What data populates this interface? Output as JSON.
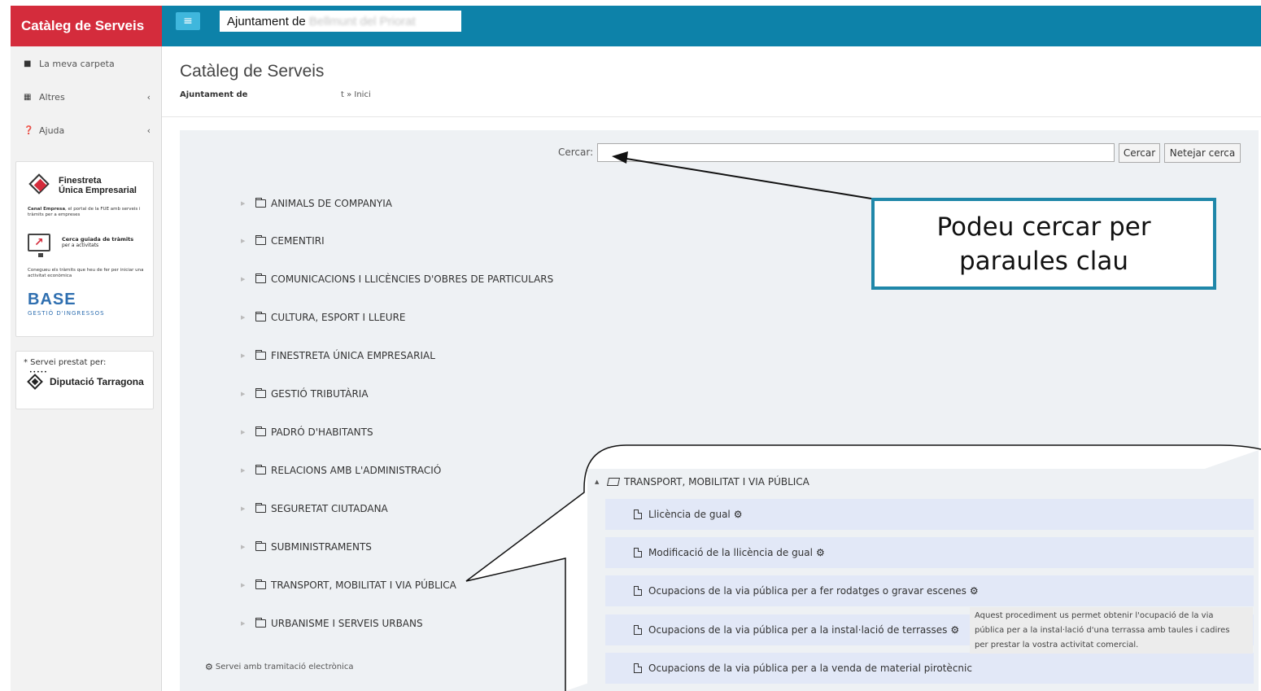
{
  "brand": {
    "title": "Catàleg de Serveis"
  },
  "sidebar": {
    "items": [
      {
        "label": "La meva carpeta",
        "icon": "folder-icon"
      },
      {
        "label": "Altres",
        "icon": "grid-icon",
        "chevron": "‹"
      },
      {
        "label": "Ajuda",
        "icon": "help-icon",
        "chevron": "‹"
      }
    ],
    "fue": {
      "line1": "Finestreta",
      "line2": "Única Empresarial",
      "desc_bold": "Canal Empresa",
      "desc": ", el portal de la FUE amb serveis i tràmits per a empreses",
      "cerca_title": "Cerca guiada de tràmits",
      "cerca_sub": "per a activitats",
      "cerca_desc": "Conegueu els tràmits que heu de fer per iniciar una activitat econòmica",
      "base": "BASE",
      "base_sub": "GESTIÓ D'INGRESSOS"
    },
    "servei": {
      "label": "* Servei prestat per:",
      "name": "Diputació Tarragona"
    }
  },
  "topbar": {
    "menu_icon": "≡",
    "org_visible": "Ajuntament de",
    "org_blurred": "Bellmunt del Priorat",
    "color": "#0d82a9"
  },
  "page": {
    "title": "Catàleg de Serveis",
    "breadcrumb_first": "Ajuntament de",
    "breadcrumb_rest": "t » Inici"
  },
  "search": {
    "label": "Cercar:",
    "value": "",
    "search_button": "Cercar",
    "clear_button": "Netejar cerca"
  },
  "categories": [
    "ANIMALS DE COMPANYIA",
    "CEMENTIRI",
    "COMUNICACIONS I LLICÈNCIES D'OBRES DE PARTICULARS",
    "CULTURA, ESPORT I LLEURE",
    "FINESTRETA ÚNICA EMPRESARIAL",
    "GESTIÓ TRIBUTÀRIA",
    "PADRÓ D'HABITANTS",
    "RELACIONS AMB L'ADMINISTRACIÓ",
    "SEGURETAT CIUTADANA",
    "SUBMINISTRAMENTS",
    "TRANSPORT, MOBILITAT I VIA PÚBLICA",
    "URBANISME I SERVEIS URBANS"
  ],
  "legend": "Servei amb tramitació electrònica",
  "callout": {
    "line1": "Podeu cercar per",
    "line2": "paraules clau",
    "border_color": "#1f87a9"
  },
  "zoom": {
    "header": "TRANSPORT, MOBILITAT I VIA PÚBLICA",
    "rows": [
      "Llicència de gual",
      "Modificació de la llicència de gual",
      "Ocupacions de la via pública per a fer rodatges o gravar escenes",
      "Ocupacions de la via pública per a la instal·lació de terrasses",
      "Ocupacions de la via pública per a la venda de material pirotècnic"
    ],
    "tooltip": [
      "Aquest procediment us permet obtenir l'ocupació de la via",
      "pública per a la instal·lació d'una terrassa amb taules i cadires",
      "per prestar la vostra activitat comercial."
    ]
  }
}
